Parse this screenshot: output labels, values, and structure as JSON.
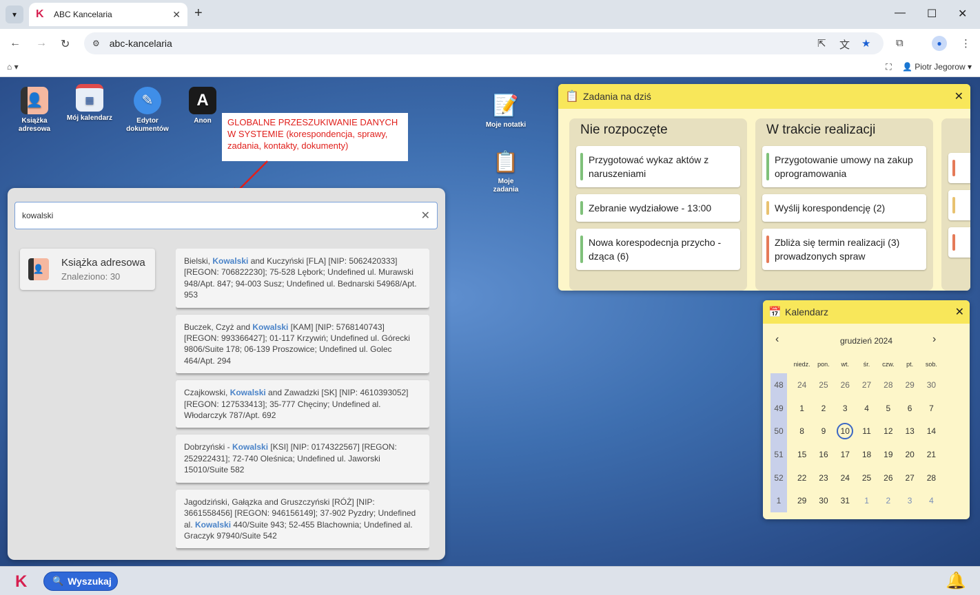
{
  "browser": {
    "tab_title": "ABC Kancelaria",
    "url": "abc-kancelaria",
    "profile_name": "Piotr Jegorow"
  },
  "desktop_icons": [
    {
      "label": "Książka adresowa",
      "icon": "address-book-icon"
    },
    {
      "label": "Mój kalendarz",
      "icon": "calendar-icon"
    },
    {
      "label": "Edytor dokumentów",
      "icon": "document-editor-icon"
    },
    {
      "label": "Anon",
      "icon": "anon-icon"
    }
  ],
  "right_icons": [
    {
      "label": "Moje notatki",
      "icon": "notes-icon"
    },
    {
      "label": "Moje zadania",
      "icon": "tasks-icon"
    }
  ],
  "annotation": "GLOBALNE PRZESZUKIWANIE DANYCH W SYSTEMIE (korespondencja, sprawy, zadania, kontakty, dokumenty)",
  "search": {
    "value": "kowalski",
    "category": {
      "title": "Książka adresowa",
      "subtitle": "Znaleziono: 30"
    },
    "results": [
      {
        "before": "Bielski, ",
        "match": "Kowalski",
        "after": " and Kuczyński [FLA] [NIP: 5062420333] [REGON: 706822230]; 75-528 Lębork; Undefined ul. Murawski 948/Apt. 847; 94-003 Susz; Undefined ul. Bednarski 54968/Apt. 953"
      },
      {
        "before": "Buczek, Czyż and ",
        "match": "Kowalski",
        "after": " [KAM] [NIP: 5768140743] [REGON: 993366427]; 01-117 Krzywiń; Undefined ul. Górecki 9806/Suite 178; 06-139 Proszowice; Undefined ul. Golec 464/Apt. 294"
      },
      {
        "before": "Czajkowski, ",
        "match": "Kowalski",
        "after": " and Zawadzki [SK] [NIP: 4610393052] [REGON: 127533413]; 35-777 Chęciny; Undefined al. Włodarczyk 787/Apt. 692"
      },
      {
        "before": "Dobrzyński - ",
        "match": "Kowalski",
        "after": " [KSI] [NIP: 0174322567] [REGON: 252922431]; 72-740 Oleśnica; Undefined ul. Jaworski 15010/Suite 582"
      },
      {
        "before": "Jagodziński, Gałązka and Gruszczyński [RÓŻ] [NIP: 3661558456] [REGON: 946156149]; 37-902 Pyzdry; Undefined al. ",
        "match": "Kowalski",
        "after": " 440/Suite 943; 52-455 Blachownia; Undefined al. Graczyk 97940/Suite 542"
      }
    ]
  },
  "tasks": {
    "title": "Zadania na dziś",
    "columns": [
      {
        "title": "Nie rozpoczęte",
        "cards": [
          {
            "text": "Przygotować wykaz aktów z naruszeniami",
            "color": "#7fc17a"
          },
          {
            "text": "Zebranie wydziałowe - 13:00",
            "color": "#7fc17a"
          },
          {
            "text": "Nowa korespodecnja przycho - dząca (6)",
            "color": "#7fc17a"
          }
        ]
      },
      {
        "title": "W trakcie realizacji",
        "cards": [
          {
            "text": "Przygotowanie umowy na zakup oprogramowania",
            "color": "#7fc17a"
          },
          {
            "text": "Wyślij korespondencję (2)",
            "color": "#e8c270"
          },
          {
            "text": "Zbliża się termin realizacji (3) prowadzonych spraw",
            "color": "#e57a58"
          }
        ]
      }
    ],
    "partial_card_colors": [
      "#e57a58",
      "#e8c270",
      "#e57a58",
      "#e8c270"
    ]
  },
  "calendar": {
    "title": "Kalendarz",
    "month": "grudzień 2024",
    "weekdays": [
      "niedz.",
      "pon.",
      "wt.",
      "śr.",
      "czw.",
      "pt.",
      "sob."
    ],
    "today": "10",
    "weeks": [
      {
        "num": "48",
        "days": [
          "24",
          "25",
          "26",
          "27",
          "28",
          "29",
          "30"
        ]
      },
      {
        "num": "49",
        "days": [
          "1",
          "2",
          "3",
          "4",
          "5",
          "6",
          "7"
        ]
      },
      {
        "num": "50",
        "days": [
          "8",
          "9",
          "10",
          "11",
          "12",
          "13",
          "14"
        ]
      },
      {
        "num": "51",
        "days": [
          "15",
          "16",
          "17",
          "18",
          "19",
          "20",
          "21"
        ]
      },
      {
        "num": "52",
        "days": [
          "22",
          "23",
          "24",
          "25",
          "26",
          "27",
          "28"
        ]
      },
      {
        "num": "1",
        "days": [
          "29",
          "30",
          "31",
          "1",
          "2",
          "3",
          "4"
        ]
      }
    ]
  },
  "taskbar": {
    "search_label": "Wyszukaj"
  }
}
